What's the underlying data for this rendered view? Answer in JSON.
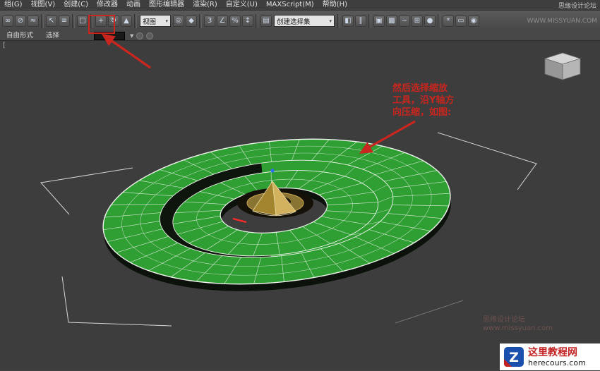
{
  "menu": {
    "items": [
      "组(G)",
      "视图(V)",
      "创建(C)",
      "修改器",
      "动画",
      "图形编辑器",
      "渲染(R)",
      "自定义(U)",
      "MAXScript(M)",
      "帮助(H)"
    ],
    "watermark_line1": "思缘设计论坛",
    "watermark_line2": "WWW.MISSYUAN.COM"
  },
  "toolbar": {
    "coord_dropdown": "视图",
    "selection_set_dropdown": "创建选择集",
    "dd_caret": "▾",
    "layout": [
      {
        "t": "i",
        "n": "select-and-link-icon",
        "g": "∞"
      },
      {
        "t": "i",
        "n": "unlink-selection-icon",
        "g": "⊘"
      },
      {
        "t": "i",
        "n": "bind-to-spacewarp-icon",
        "g": "≈"
      },
      {
        "t": "s"
      },
      {
        "t": "i",
        "n": "select-object-icon",
        "g": "↖"
      },
      {
        "t": "i",
        "n": "select-by-name-icon",
        "g": "≡"
      },
      {
        "t": "s"
      },
      {
        "t": "i",
        "n": "selection-region-icon",
        "g": "□"
      },
      {
        "t": "s"
      },
      {
        "t": "i",
        "n": "select-move-icon",
        "g": "+"
      },
      {
        "t": "i",
        "n": "select-rotate-icon",
        "g": "↻"
      },
      {
        "t": "i",
        "n": "select-scale-icon",
        "g": "▲"
      },
      {
        "t": "s"
      },
      {
        "t": "d",
        "n": "reference-coordinate-dropdown",
        "key": "coord_dropdown",
        "w": 44
      },
      {
        "t": "i",
        "n": "use-pivot-center-icon",
        "g": "◎"
      },
      {
        "t": "i",
        "n": "select-manipulate-icon",
        "g": "◆"
      },
      {
        "t": "s"
      },
      {
        "t": "i",
        "n": "snap-toggle-icon",
        "g": "3"
      },
      {
        "t": "i",
        "n": "angle-snap-icon",
        "g": "∠"
      },
      {
        "t": "i",
        "n": "percent-snap-icon",
        "g": "%"
      },
      {
        "t": "i",
        "n": "spinner-snap-icon",
        "g": "↕"
      },
      {
        "t": "s"
      },
      {
        "t": "i",
        "n": "edit-named-selection-icon",
        "g": "▤"
      },
      {
        "t": "d",
        "n": "named-selection-dropdown",
        "key": "selection_set_dropdown",
        "w": 86
      },
      {
        "t": "s"
      },
      {
        "t": "i",
        "n": "mirror-icon",
        "g": "◧"
      },
      {
        "t": "i",
        "n": "align-icon",
        "g": "∥"
      },
      {
        "t": "s"
      },
      {
        "t": "i",
        "n": "layer-manager-icon",
        "g": "▣"
      },
      {
        "t": "i",
        "n": "graphite-ribbon-icon",
        "g": "▩"
      },
      {
        "t": "i",
        "n": "curve-editor-icon",
        "g": "~"
      },
      {
        "t": "i",
        "n": "schematic-view-icon",
        "g": "⊞"
      },
      {
        "t": "i",
        "n": "material-editor-icon",
        "g": "●"
      },
      {
        "t": "s"
      },
      {
        "t": "i",
        "n": "render-setup-icon",
        "g": "*"
      },
      {
        "t": "i",
        "n": "render-frame-icon",
        "g": "▭"
      },
      {
        "t": "i",
        "n": "render-production-icon",
        "g": "◉"
      }
    ]
  },
  "ribbon": {
    "tabs": [
      "自由形式",
      "选择"
    ],
    "caret": "▼"
  },
  "viewport": {
    "corner_label": "[",
    "annotation_lines": [
      "然后选择缩放",
      "工具，沿Y轴方",
      "向压缩，如图:"
    ],
    "watermark_faint_1": "思缘设计论坛",
    "watermark_faint_2": "www.missyuan.com"
  },
  "badge": {
    "title": "这里教程网",
    "domain": "herecours.com",
    "logo_letter": "Z"
  },
  "colors": {
    "annotation_red": "#c8261f",
    "spiral_green": "#2f9e33",
    "wireframe": "#ddeedd",
    "cone_light": "#d2b25e",
    "cone_dark": "#a3852f",
    "badge_blue": "#1b4fae",
    "badge_red": "#c32222"
  }
}
